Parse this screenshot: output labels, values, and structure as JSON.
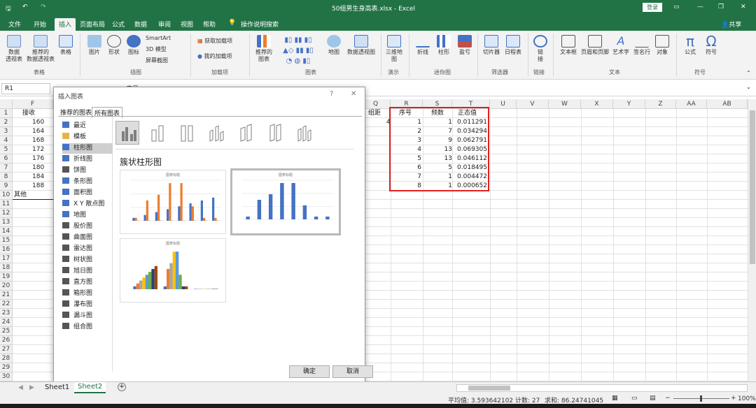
{
  "titlebar": {
    "filename": "50组男生身高表.xlsx - Excel",
    "login": "登录",
    "share": "共享"
  },
  "tabs": [
    "文件",
    "开始",
    "插入",
    "页面布局",
    "公式",
    "数据",
    "审阅",
    "视图",
    "帮助"
  ],
  "tell_me": "操作说明搜索",
  "ribbon": {
    "groups": [
      "表格",
      "插图",
      "加载项",
      "图表",
      "演示",
      "迷你图",
      "筛选器",
      "链接",
      "文本",
      "符号"
    ],
    "buttons": [
      "数据\n透视表",
      "推荐的\n数据透视表",
      "表格",
      "图片",
      "形状",
      "图标",
      "SmartArt",
      "3D 模型",
      "屏幕截图",
      "获取加载项",
      "我的加载项",
      "推荐的\n图表",
      "地图",
      "数据透视图",
      "三维地\n图",
      "折线",
      "柱形",
      "盈亏",
      "切片器",
      "日程表",
      "链\n接",
      "文本框",
      "页眉和页脚",
      "艺术字",
      "签名行",
      "对象",
      "公式",
      "符号"
    ]
  },
  "namebox": "R1",
  "formula_partial": "序号",
  "columns": [
    "F",
    "Q",
    "R",
    "S",
    "T",
    "U",
    "V",
    "W",
    "X",
    "Y",
    "Z",
    "AA",
    "AB"
  ],
  "rows": [
    "1",
    "2",
    "3",
    "4",
    "5",
    "6",
    "7",
    "8",
    "9",
    "10",
    "11",
    "12",
    "13",
    "14",
    "15",
    "16",
    "17",
    "18",
    "19",
    "20",
    "21",
    "22",
    "23",
    "24",
    "25",
    "26",
    "27",
    "28",
    "29",
    "30"
  ],
  "col_f": {
    "header": "接收",
    "values": [
      "160",
      "164",
      "168",
      "172",
      "176",
      "180",
      "184",
      "188"
    ],
    "other": "其他"
  },
  "col_q": {
    "header": "组距",
    "value": "4"
  },
  "table": {
    "headers": [
      "序号",
      "频数",
      "正态值"
    ],
    "rows": [
      [
        "1",
        "1",
        "0.011291"
      ],
      [
        "2",
        "7",
        "0.034294"
      ],
      [
        "3",
        "9",
        "0.062791"
      ],
      [
        "4",
        "13",
        "0.069305"
      ],
      [
        "5",
        "13",
        "0.046112"
      ],
      [
        "6",
        "5",
        "0.018495"
      ],
      [
        "7",
        "1",
        "0.004472"
      ],
      [
        "8",
        "1",
        "0.000652"
      ]
    ]
  },
  "dialog": {
    "title": "插入图表",
    "help": "?",
    "close": "✕",
    "tabs": [
      "推荐的图表",
      "所有图表"
    ],
    "types": [
      "最近",
      "模板",
      "柱形图",
      "折线图",
      "饼图",
      "条形图",
      "面积图",
      "X Y 散点图",
      "地图",
      "股价图",
      "曲面图",
      "雷达图",
      "树状图",
      "旭日图",
      "直方图",
      "箱形图",
      "瀑布图",
      "漏斗图",
      "组合图"
    ],
    "selected_type": "柱形图",
    "subtype_title": "簇状柱形图",
    "thumb_title": "图表标题",
    "ok": "确定",
    "cancel": "取消"
  },
  "sheets": [
    "Sheet1",
    "Sheet2"
  ],
  "status": {
    "average": "平均值: 3.593642102",
    "count": "计数: 27",
    "sum": "求和: 86.24741045",
    "zoom": "100%"
  },
  "colors": {
    "excel_green": "#217346",
    "series_blue": "#4472c4",
    "series_orange": "#ed7d31",
    "series_gray": "#a5a5a5",
    "highlight_red": "#e02020"
  }
}
